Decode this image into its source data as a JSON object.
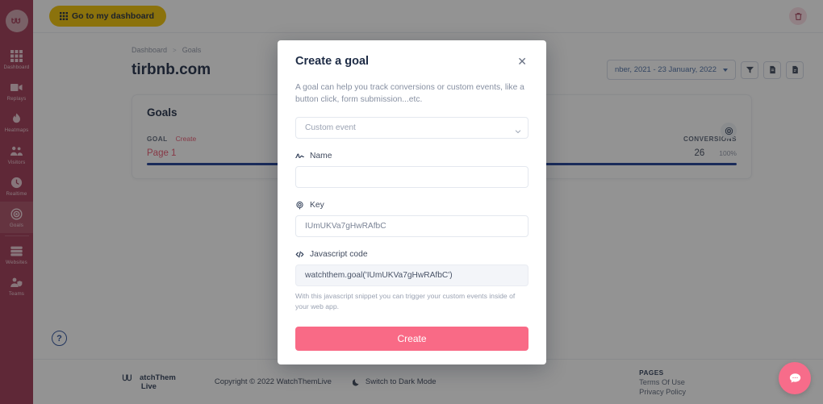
{
  "sidebar": {
    "logo_icon": "watchthemlive-logo-icon",
    "items": [
      {
        "label": "Dashboard",
        "icon": "grid-icon",
        "active": false
      },
      {
        "label": "Replays",
        "icon": "video-icon",
        "active": false
      },
      {
        "label": "Heatmaps",
        "icon": "flame-icon",
        "active": false
      },
      {
        "label": "Visitors",
        "icon": "users-icon",
        "active": false
      },
      {
        "label": "Realtime",
        "icon": "clock-icon",
        "active": false
      },
      {
        "label": "Goals",
        "icon": "target-icon",
        "active": true
      },
      {
        "label": "Websites",
        "icon": "server-icon",
        "active": false
      },
      {
        "label": "Teams",
        "icon": "team-icon",
        "active": false
      }
    ]
  },
  "topbar": {
    "dashboard_button": "Go to my dashboard",
    "dashboard_icon": "grid-icon",
    "delete_icon": "trash-icon"
  },
  "breadcrumb": {
    "root": "Dashboard",
    "separator": ">",
    "current": "Goals"
  },
  "page": {
    "title": "tirbnb.com"
  },
  "toolbar": {
    "date_range": "nber, 2021 - 23 January, 2022",
    "filter_icon": "funnel-icon",
    "export_icon": "file-export-icon",
    "pdf_icon": "file-pdf-icon"
  },
  "goals_card": {
    "heading": "Goals",
    "badge_icon": "target-icon",
    "col_goal": "GOAL",
    "col_create": "Create",
    "col_conversions": "CONVERSIONS",
    "rows": [
      {
        "name": "Page 1",
        "conversions": "26",
        "percent": "100%",
        "bar_pct": 100
      }
    ]
  },
  "help": {
    "label": "?"
  },
  "footer": {
    "logo_line1": "atchThem",
    "logo_line2": "Live",
    "logo_icon": "watchthemlive-logo-icon",
    "copyright": "Copyright © 2022 WatchThemLive",
    "dark_mode": "Switch to Dark Mode",
    "dark_mode_icon": "moon-icon",
    "pages_heading": "PAGES",
    "links": [
      "Terms Of Use",
      "Privacy Policy"
    ]
  },
  "chat": {
    "icon": "chat-bubble-icon"
  },
  "modal": {
    "title": "Create a goal",
    "close_icon": "close-icon",
    "description": "A goal can help you track conversions or custom events, like a button click, form submission...etc.",
    "type_select": {
      "value": "Custom event",
      "options": [
        "Custom event"
      ],
      "chevron_icon": "chevron-down-icon"
    },
    "name_field": {
      "label": "Name",
      "icon": "signature-icon",
      "value": "",
      "placeholder": ""
    },
    "key_field": {
      "label": "Key",
      "icon": "fingerprint-icon",
      "value": "IUmUKVa7gHwRAfbC"
    },
    "js_field": {
      "label": "Javascript code",
      "icon": "code-icon",
      "value": "watchthem.goal('IUmUKVa7gHwRAfbC')",
      "hint": "With this javascript snippet you can trigger your custom events inside of your web app."
    },
    "submit_label": "Create"
  },
  "colors": {
    "sidebar": "#9e3551",
    "accent_pink": "#f96a86",
    "goal_bar_blue": "#1b3c94",
    "dashboard_yellow": "#f0c000",
    "overlay": "rgba(25,25,25,0.47)"
  }
}
